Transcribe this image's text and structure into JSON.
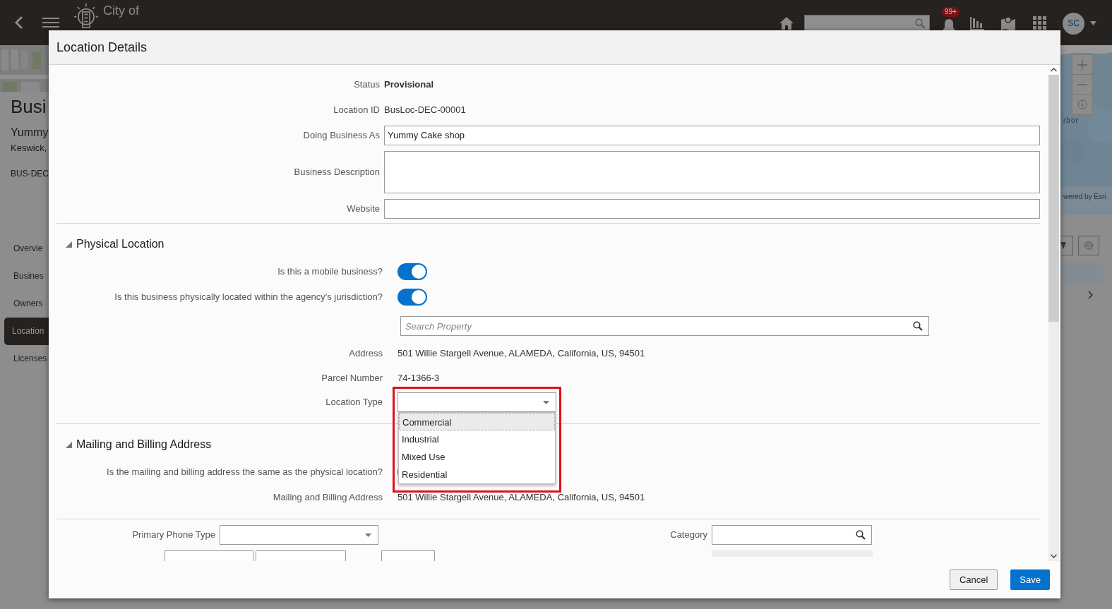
{
  "app_header": {
    "logo_top": "City of",
    "notification_badge": "99+",
    "avatar": "SC"
  },
  "background_page": {
    "title": "Busi",
    "name": "Yummy",
    "city": "Keswick,",
    "record_id": "BUS-DEC",
    "nav": [
      {
        "label": "Overvie",
        "selected": false
      },
      {
        "label": "Busines",
        "selected": false
      },
      {
        "label": "Owners",
        "selected": false
      },
      {
        "label": "Location",
        "selected": true
      },
      {
        "label": "Licenses",
        "selected": false
      }
    ],
    "map_labels": [
      "rbor",
      "wered by Esri"
    ]
  },
  "dialog": {
    "title": "Location Details",
    "general_fields": [
      {
        "kind": "text",
        "label": "Status",
        "value": "Provisional",
        "bold": true
      },
      {
        "kind": "text",
        "label": "Location ID",
        "value": "BusLoc-DEC-00001",
        "bold": false
      },
      {
        "kind": "input",
        "label": "Doing Business As",
        "value": "Yummy Cake shop"
      },
      {
        "kind": "textarea",
        "label": "Business Description"
      },
      {
        "kind": "input",
        "label": "Website"
      }
    ],
    "sections": [
      {
        "title": "Physical Location",
        "expanded": true,
        "fields": [
          {
            "kind": "toggle",
            "label": "Is this a mobile business?",
            "on": true
          },
          {
            "kind": "toggle",
            "label": "Is this business physically located within the agency's jurisdiction?",
            "on": true
          },
          {
            "kind": "search",
            "placeholder": "Search Property"
          },
          {
            "kind": "text",
            "label": "Address",
            "value": "501 Willie Stargell Avenue, ALAMEDA, California, US, 94501"
          },
          {
            "kind": "text",
            "label": "Parcel Number",
            "value": "74-1366-3"
          },
          {
            "kind": "select",
            "label": "Location Type",
            "open": true,
            "annotated": true,
            "options": [
              {
                "label": "Commercial",
                "selected": true
              },
              {
                "label": "Industrial",
                "selected": false
              },
              {
                "label": "Mixed Use",
                "selected": false
              },
              {
                "label": "Residential",
                "selected": false
              }
            ]
          }
        ]
      },
      {
        "title": "Mailing and Billing Address",
        "expanded": true,
        "fields": [
          {
            "kind": "toggle",
            "label": "Is the mailing and billing address the same as the physical location?",
            "on": true
          },
          {
            "kind": "text",
            "label": "Mailing and Billing Address",
            "value": "501 Willie Stargell Avenue, ALAMEDA, California, US, 94501"
          }
        ]
      }
    ],
    "contact_fields": [
      {
        "kind": "select",
        "label": "Primary Phone Type"
      },
      {
        "kind": "search",
        "label": "Category"
      }
    ],
    "buttons": [
      {
        "label": "Cancel",
        "primary": false
      },
      {
        "label": "Save",
        "primary": true
      }
    ]
  }
}
